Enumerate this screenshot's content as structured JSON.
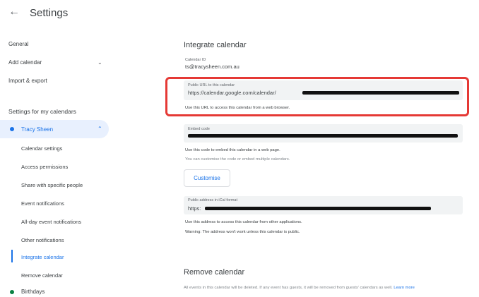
{
  "header": {
    "back_icon": "←",
    "title": "Settings"
  },
  "sidebar": {
    "general": "General",
    "add_calendar": "Add calendar",
    "import_export": "Import & export",
    "section_title": "Settings for my calendars",
    "calendar": {
      "name": "Tracy Sheen",
      "color": "#1a73e8"
    },
    "items": [
      "Calendar settings",
      "Access permissions",
      "Share with specific people",
      "Event notifications",
      "All-day event notifications",
      "Other notifications",
      "Integrate calendar",
      "Remove calendar"
    ],
    "active_item": "Integrate calendar",
    "birthdays": {
      "name": "Birthdays",
      "color": "#0b8043"
    }
  },
  "integrate": {
    "title": "Integrate calendar",
    "calendar_id_label": "Calendar ID",
    "calendar_id": "ts@tracysheen.com.au",
    "public_url_label": "Public URL to this calendar",
    "public_url": "https://calendar.google.com/calendar/",
    "public_url_hint": "Use this URL to access this calendar from a web browser.",
    "embed_label": "Embed code",
    "embed_hint": "Use this code to embed this calendar in a web page.",
    "embed_hint2": "You can customise the code or embed multiple calendars.",
    "customise_button": "Customise",
    "ical_label": "Public address in iCal format",
    "ical_value": "https:",
    "ical_hint": "Use this address to access this calendar from other applications.",
    "ical_warning": "Warning: The address won't work unless this calendar is public."
  },
  "remove": {
    "title": "Remove calendar",
    "desc": "All events in this calendar will be deleted. If any event has guests, it will be removed from guests' calendars as well.",
    "learn_more": "Learn more"
  },
  "colors": {
    "highlight": "#e53935",
    "accent": "#1a73e8"
  }
}
